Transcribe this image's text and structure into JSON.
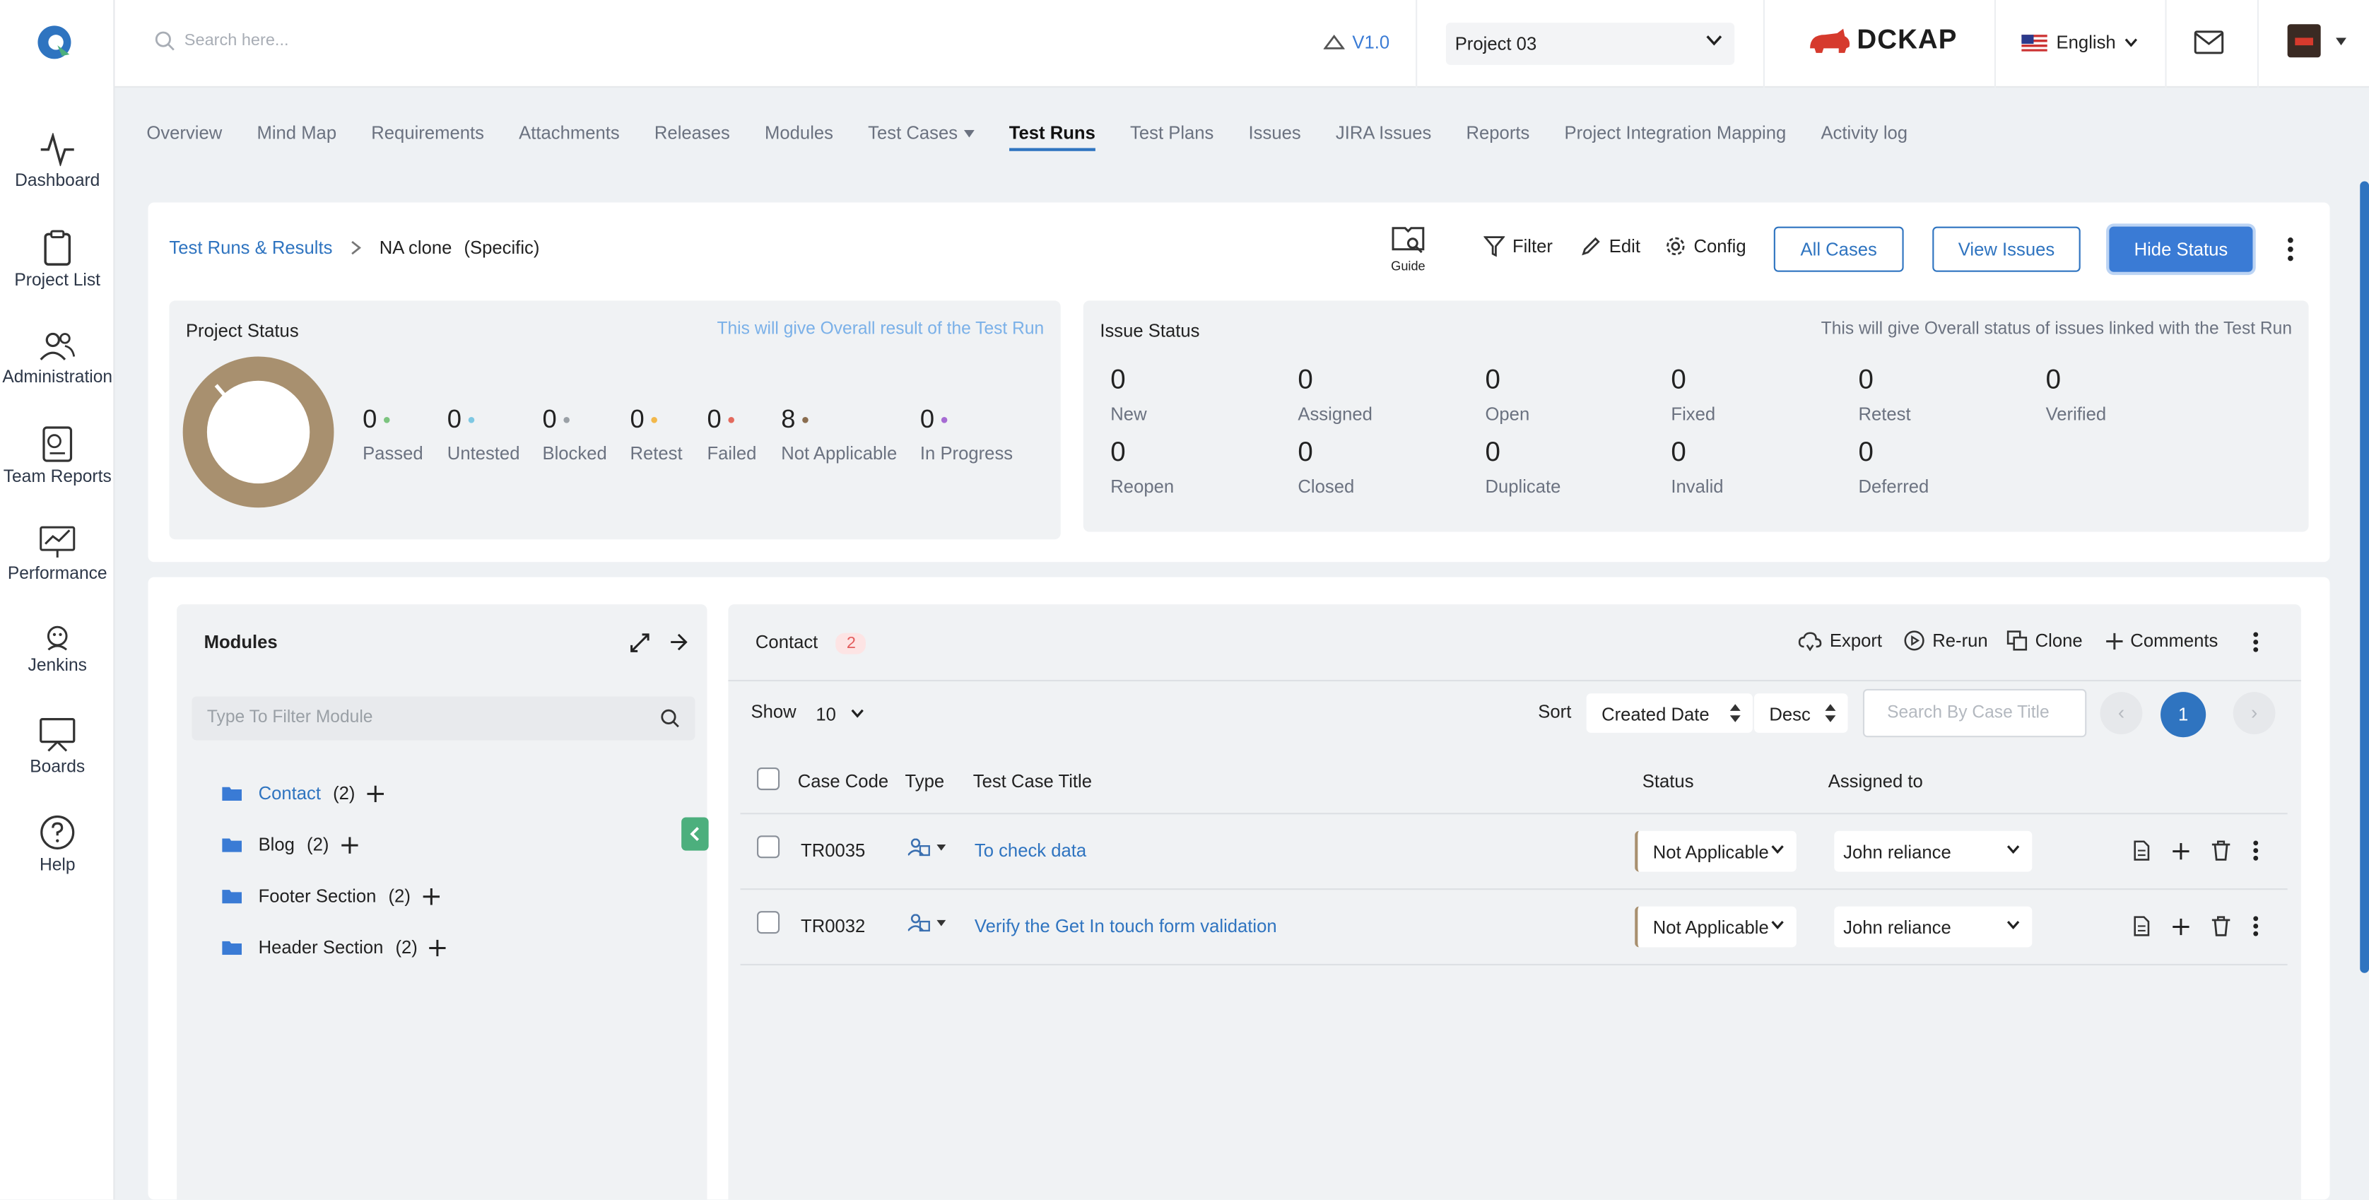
{
  "app": {
    "search_placeholder": "Search here...",
    "version": "V1.0",
    "project": "Project 03",
    "brand": "DCKAP",
    "language": "English"
  },
  "sidebar": [
    {
      "label": "Dashboard",
      "icon": "activity-icon"
    },
    {
      "label": "Project List",
      "icon": "clipboard-icon"
    },
    {
      "label": "Administration",
      "icon": "users-icon"
    },
    {
      "label": "Team Reports",
      "icon": "report-icon"
    },
    {
      "label": "Performance",
      "icon": "performance-icon"
    },
    {
      "label": "Jenkins",
      "icon": "jenkins-icon"
    },
    {
      "label": "Boards",
      "icon": "board-icon"
    },
    {
      "label": "Help",
      "icon": "help-icon"
    }
  ],
  "tabs": [
    "Overview",
    "Mind Map",
    "Requirements",
    "Attachments",
    "Releases",
    "Modules",
    "Test Cases",
    "Test Runs",
    "Test Plans",
    "Issues",
    "JIRA Issues",
    "Reports",
    "Project Integration Mapping",
    "Activity log"
  ],
  "active_tab": "Test Runs",
  "header": {
    "breadcrumb_link": "Test Runs & Results",
    "breadcrumb_current": "NA clone",
    "breadcrumb_type": "(Specific)",
    "guide": "Guide",
    "filter": "Filter",
    "edit": "Edit",
    "config": "Config",
    "all_cases": "All Cases",
    "view_issues": "View Issues",
    "hide_status": "Hide Status"
  },
  "project_status": {
    "title": "Project Status",
    "hint": "This will give Overall result of the Test Run",
    "stats": [
      {
        "value": "0",
        "label": "Passed",
        "color": "#7cc47f"
      },
      {
        "value": "0",
        "label": "Untested",
        "color": "#7ec8e3"
      },
      {
        "value": "0",
        "label": "Blocked",
        "color": "#9aa0a6"
      },
      {
        "value": "0",
        "label": "Retest",
        "color": "#f2b84b"
      },
      {
        "value": "0",
        "label": "Failed",
        "color": "#e36a5d"
      },
      {
        "value": "8",
        "label": "Not Applicable",
        "color": "#8a6d4f"
      },
      {
        "value": "0",
        "label": "In Progress",
        "color": "#a66bd3"
      }
    ]
  },
  "issue_status": {
    "title": "Issue Status",
    "hint": "This will give Overall status of issues linked with the Test Run",
    "row1": [
      {
        "value": "0",
        "label": "New"
      },
      {
        "value": "0",
        "label": "Assigned"
      },
      {
        "value": "0",
        "label": "Open"
      },
      {
        "value": "0",
        "label": "Fixed"
      },
      {
        "value": "0",
        "label": "Retest"
      },
      {
        "value": "0",
        "label": "Verified"
      }
    ],
    "row2": [
      {
        "value": "0",
        "label": "Reopen"
      },
      {
        "value": "0",
        "label": "Closed"
      },
      {
        "value": "0",
        "label": "Duplicate"
      },
      {
        "value": "0",
        "label": "Invalid"
      },
      {
        "value": "0",
        "label": "Deferred"
      }
    ]
  },
  "modules": {
    "title": "Modules",
    "filter_placeholder": "Type To Filter Module",
    "items": [
      {
        "name": "Contact",
        "count": "(2)",
        "active": true
      },
      {
        "name": "Blog",
        "count": "(2)",
        "active": false
      },
      {
        "name": "Footer Section",
        "count": "(2)",
        "active": false
      },
      {
        "name": "Header Section",
        "count": "(2)",
        "active": false
      }
    ]
  },
  "cases": {
    "module": "Contact",
    "count": "2",
    "export": "Export",
    "rerun": "Re-run",
    "clone": "Clone",
    "comments": "Comments",
    "show_label": "Show",
    "show_value": "10",
    "sort_label": "Sort",
    "sort_field": "Created Date",
    "sort_order": "Desc",
    "search_placeholder": "Search By Case Title",
    "page": "1",
    "columns": {
      "code": "Case Code",
      "type": "Type",
      "title": "Test Case Title",
      "status": "Status",
      "assigned": "Assigned to"
    },
    "rows": [
      {
        "code": "TR0035",
        "title": "To check data",
        "status": "Not Applicable",
        "assigned": "John reliance"
      },
      {
        "code": "TR0032",
        "title": "Verify the Get In touch form validation",
        "status": "Not Applicable",
        "assigned": "John reliance"
      }
    ]
  }
}
